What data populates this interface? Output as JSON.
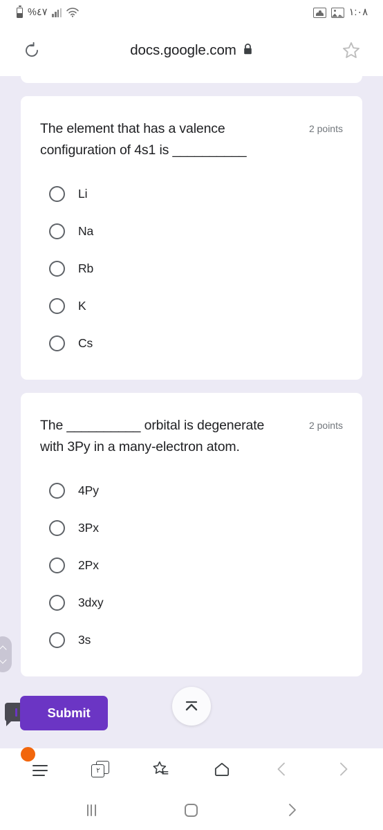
{
  "statusbar": {
    "battery_percent": "%٤٧",
    "time": "١:٠٨",
    "battery_icon": "battery-icon",
    "signal_icon": "signal-bars-icon",
    "wifi_icon": "wifi-icon",
    "people_icon": "contacts-notification-icon",
    "image_icon": "screenshot-notification-icon"
  },
  "browser": {
    "reload_icon": "reload-icon",
    "url": "docs.google.com",
    "lock_icon": "lock-icon",
    "bookmark_icon": "star-outline-icon",
    "toolbar": {
      "menu_icon": "hamburger-menu-icon",
      "menu_badge": "",
      "tab_count": "٢",
      "tabs_icon": "tabs-icon",
      "bookmarks_icon": "bookmarks-star-icon",
      "home_icon": "home-icon",
      "back_icon": "back-chevron-icon",
      "forward_icon": "forward-chevron-icon"
    }
  },
  "form": {
    "questions": [
      {
        "text": "The element that has a valence configuration of 4s1 is __________",
        "points": "2 points",
        "options": [
          "Li",
          "Na",
          "Rb",
          "K",
          "Cs"
        ]
      },
      {
        "text": "The __________ orbital is degenerate with 3Py in a many-electron atom.",
        "points": "2 points",
        "options": [
          "4Py",
          "3Px",
          "2Px",
          "3dxy",
          "3s"
        ]
      }
    ],
    "submit_label": "Submit",
    "submit_color": "#6b35c4",
    "scroll_top_icon": "scroll-to-top-icon",
    "chat_badge_icon": "chat-bubble-icon",
    "scroll_indicator_icon": "scroll-handle-icon"
  },
  "navbar": {
    "recents_icon": "recents-icon",
    "home_icon": "home-button-icon",
    "back_icon": "back-button-icon"
  },
  "colors": {
    "page_bg": "#eceaf5",
    "card_bg": "#ffffff",
    "accent": "#6b35c4",
    "badge_orange": "#f2660c"
  }
}
